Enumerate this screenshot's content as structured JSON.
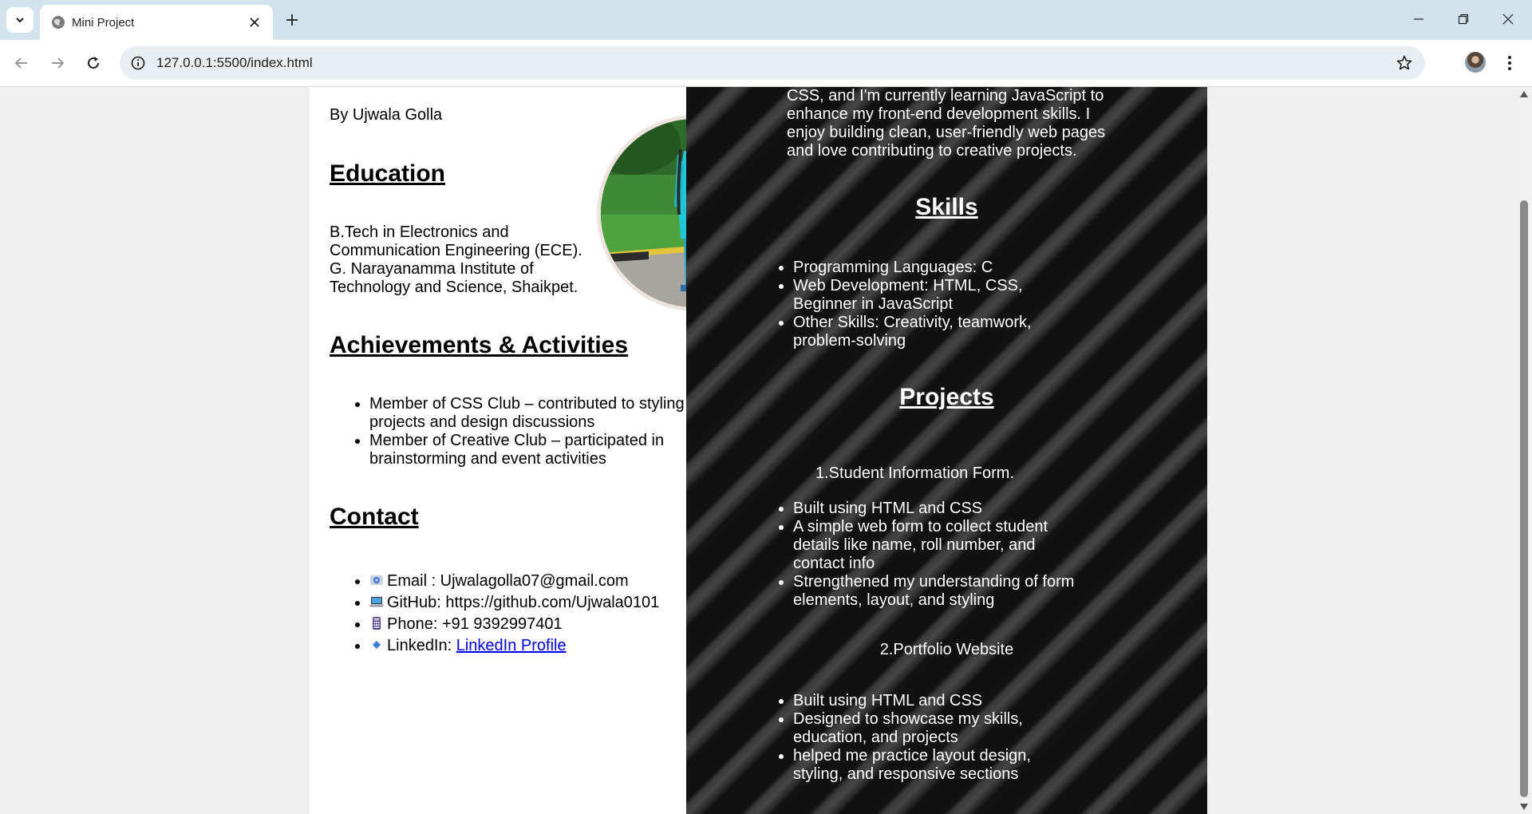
{
  "browser": {
    "tab_title": "Mini Project",
    "url": "127.0.0.1:5500/index.html"
  },
  "icons": {
    "tab_menu": "chevron-down-icon",
    "favicon": "globe-icon",
    "close": "close-icon",
    "new_tab": "plus-icon",
    "back": "arrow-left-icon",
    "forward": "arrow-right-icon",
    "reload": "reload-icon",
    "site_info": "info-icon",
    "bookmark": "star-icon",
    "email": "email-icon",
    "github": "laptop-icon",
    "phone": "phone-icon",
    "linkedin": "diamond-icon"
  },
  "colors": {
    "link": "#0000ee",
    "dark_panel": "#111111",
    "chrome_tabbar": "#d3e3ee"
  },
  "left": {
    "author": "By Ujwala Golla",
    "education_heading": "Education",
    "education_lines": [
      "B.Tech in Electronics and",
      "Communication Engineering (ECE).",
      "G. Narayanamma Institute of",
      "Technology and Science, Shaikpet."
    ],
    "achievements_heading": "Achievements & Activities",
    "achievements": [
      "Member of CSS Club – contributed to styling projects and design discussions",
      "Member of Creative Club – participated in brainstorming and event activities"
    ],
    "contact_heading": "Contact",
    "contact": {
      "email_label": "Email : Ujwalagolla07@gmail.com",
      "github_label": "GitHub: https://github.com/Ujwala0101",
      "phone_label": "Phone: +91 9392997401",
      "linkedin_label": "LinkedIn: ",
      "linkedin_link": "LinkedIn Profile"
    }
  },
  "right": {
    "about_lines": [
      "CSS, and I'm currently learning JavaScript to",
      "enhance my front-end development skills. I",
      "enjoy building clean, user-friendly web pages",
      "and love contributing to creative projects."
    ],
    "skills_heading": "Skills",
    "skills": [
      "Programming Languages: C",
      "Web Development: HTML, CSS, Beginner in JavaScript",
      "Other Skills: Creativity, teamwork, problem-solving"
    ],
    "projects_heading": "Projects",
    "project1_title": "1.Student Information Form.",
    "project1_points": [
      "Built using HTML and CSS",
      "A simple web form to collect student details like name, roll number, and contact info",
      "Strengthened my understanding of form elements, layout, and styling"
    ],
    "project2_title": "2.Portfolio Website",
    "project2_points": [
      "Built using HTML and CSS",
      "Designed to showcase my skills, education, and projects",
      "helped me practice layout design, styling, and responsive sections"
    ]
  }
}
